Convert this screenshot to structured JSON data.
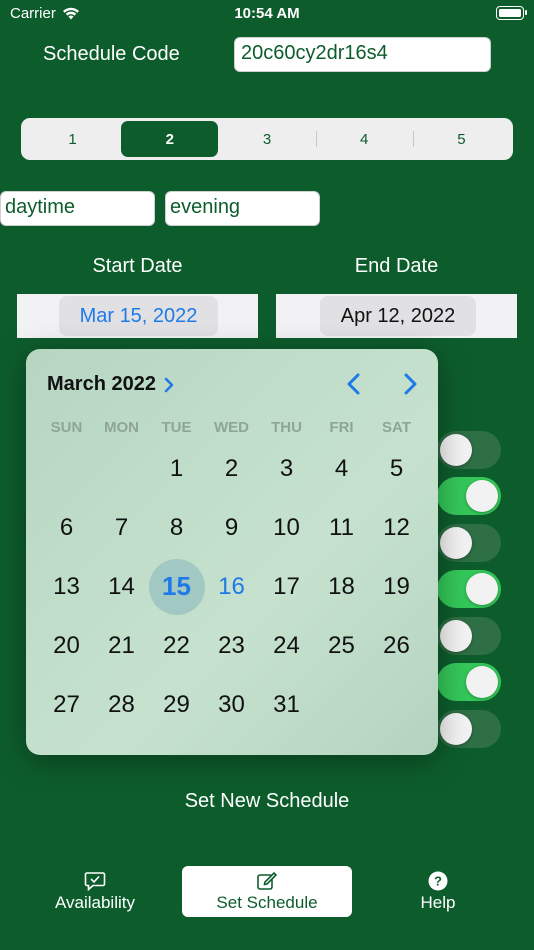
{
  "status": {
    "carrier": "Carrier",
    "time": "10:54 AM"
  },
  "schedule_code": {
    "label": "Schedule Code",
    "value": "20c60cy2dr16s4"
  },
  "segments": [
    "1",
    "2",
    "3",
    "4",
    "5"
  ],
  "selected_segment": "2",
  "period_fields": {
    "daytime": "daytime",
    "evening": "evening"
  },
  "dates": {
    "start_label": "Start Date",
    "end_label": "End Date",
    "start_value": "Mar 15, 2022",
    "end_value": "Apr 12, 2022"
  },
  "toggles": [
    "off",
    "on",
    "off",
    "on",
    "off",
    "on",
    "off"
  ],
  "calendar": {
    "month_title": "March 2022",
    "weekdays": [
      "SUN",
      "MON",
      "TUE",
      "WED",
      "THU",
      "FRI",
      "SAT"
    ],
    "first_weekday_index": 2,
    "days_in_month": 31,
    "selected_day": 15,
    "today": 16
  },
  "set_new_schedule": "Set New Schedule",
  "tabs": {
    "availability": "Availability",
    "set_schedule": "Set Schedule",
    "help": "Help"
  },
  "colors": {
    "primary": "#0d5d2c",
    "accent": "#1f7ae8",
    "toggle_on": "#34c759"
  }
}
